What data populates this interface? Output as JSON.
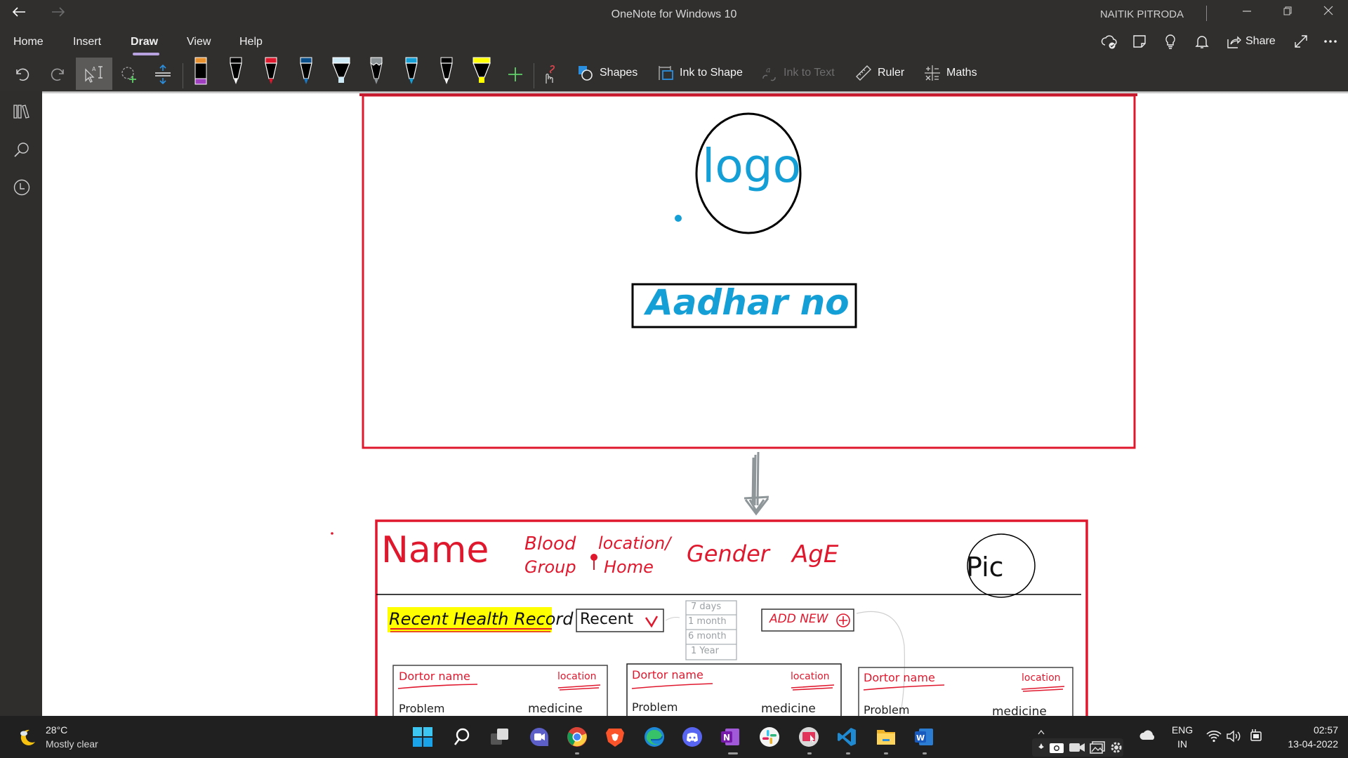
{
  "window": {
    "title": "OneNote for Windows 10",
    "user": "NAITIK PITRODA",
    "back_icon": "arrow-left-icon",
    "forward_icon": "arrow-right-icon",
    "controls": [
      "minimize",
      "restore",
      "close"
    ]
  },
  "menu": {
    "tabs": [
      {
        "label": "Home",
        "active": false
      },
      {
        "label": "Insert",
        "active": false
      },
      {
        "label": "Draw",
        "active": true
      },
      {
        "label": "View",
        "active": false
      },
      {
        "label": "Help",
        "active": false
      }
    ],
    "right": {
      "share_label": "Share",
      "icons": [
        "sync-status-icon",
        "sticky-note-icon",
        "lightbulb-icon",
        "bell-icon",
        "share-icon",
        "fullscreen-icon",
        "more-icon"
      ]
    },
    "accent": "#b8a3e0"
  },
  "toolbar": {
    "icons": [
      "undo-icon",
      "redo-icon",
      "type-select-icon",
      "lasso-select-icon",
      "add-space-icon"
    ],
    "pens": [
      {
        "type": "pen",
        "color": "#000000",
        "cap": "#e8912d",
        "band": "#a040c0"
      },
      {
        "type": "pen",
        "color": "#000000",
        "cap": "#000000",
        "tip": "#ffffff"
      },
      {
        "type": "pen",
        "color": "#e0182e",
        "cap": "#e0182e",
        "tip": "#e0182e"
      },
      {
        "type": "pen",
        "color": "#0a4f8a",
        "cap": "#0a4f8a",
        "tip": "#1a78c2"
      },
      {
        "type": "highlighter",
        "color": "#cfeaf7",
        "cap": "#cfeaf7",
        "tip": "#cfeaf7"
      },
      {
        "type": "pencil",
        "color": "#8c9396",
        "cap": "#8c9396",
        "tip": "#8c9396"
      },
      {
        "type": "pen",
        "color": "#149fd6",
        "cap": "#149fd6",
        "tip": "#149fd6"
      },
      {
        "type": "pen",
        "color": "#000000",
        "cap": "#000000",
        "tip": "#ffffff"
      },
      {
        "type": "highlighter",
        "color": "#ffff00",
        "cap": "#ffff00",
        "tip": "#ffff00"
      }
    ],
    "add_pen_icon": "plus-icon",
    "touch_draw_icon": "touch-draw-icon",
    "buttons": [
      {
        "label": "Shapes",
        "icon": "shapes-icon",
        "enabled": true
      },
      {
        "label": "Ink to Shape",
        "icon": "ink-to-shape-icon",
        "enabled": true
      },
      {
        "label": "Ink to Text",
        "icon": "ink-to-text-icon",
        "enabled": false
      },
      {
        "label": "Ruler",
        "icon": "ruler-icon",
        "enabled": true
      },
      {
        "label": "Maths",
        "icon": "maths-icon",
        "enabled": true
      }
    ]
  },
  "sidebar": {
    "icons": [
      "notebooks-icon",
      "search-icon",
      "recent-icon"
    ]
  },
  "sketch": {
    "frame1": {
      "logo_text": "logo",
      "aadhar_text": "Aadhar no"
    },
    "frame2": {
      "header_fields": [
        "Name",
        "Blood",
        "Group",
        "location/",
        "Home",
        "Gender",
        "AgE"
      ],
      "pic_label": "Pic",
      "section_title": "Recent Health Record",
      "dropdown_value": "Recent",
      "dropdown_options": [
        "7 days",
        "1 month",
        "6 month",
        "1 Year"
      ],
      "add_new_label": "ADD NEW",
      "cards": [
        {
          "doctor": "Dortor name",
          "location": "location",
          "problem": "Problem",
          "medicine": "medicine"
        },
        {
          "doctor": "Dortor name",
          "location": "location",
          "problem": "Problem",
          "medicine": "medicine"
        },
        {
          "doctor": "Dortor name",
          "location": "location",
          "problem": "Problem",
          "medicine": "medicine"
        }
      ]
    },
    "colors": {
      "frame": "#e0182e",
      "ink_blue": "#149fd6",
      "highlight": "#ffff00"
    }
  },
  "taskbar": {
    "weather": {
      "temp": "28°C",
      "condition": "Mostly clear"
    },
    "apps": [
      "start-icon",
      "search-icon",
      "task-view-icon",
      "teams-chat-icon",
      "chrome-icon",
      "brave-icon",
      "edge-icon",
      "discord-icon",
      "onenote-icon",
      "slack-icon",
      "screen-recorder-icon",
      "vscode-icon",
      "file-explorer-icon",
      "word-icon"
    ],
    "tray": {
      "lang_top": "ENG",
      "lang_bottom": "IN",
      "time": "02:57",
      "date": "13-04-2022"
    }
  }
}
